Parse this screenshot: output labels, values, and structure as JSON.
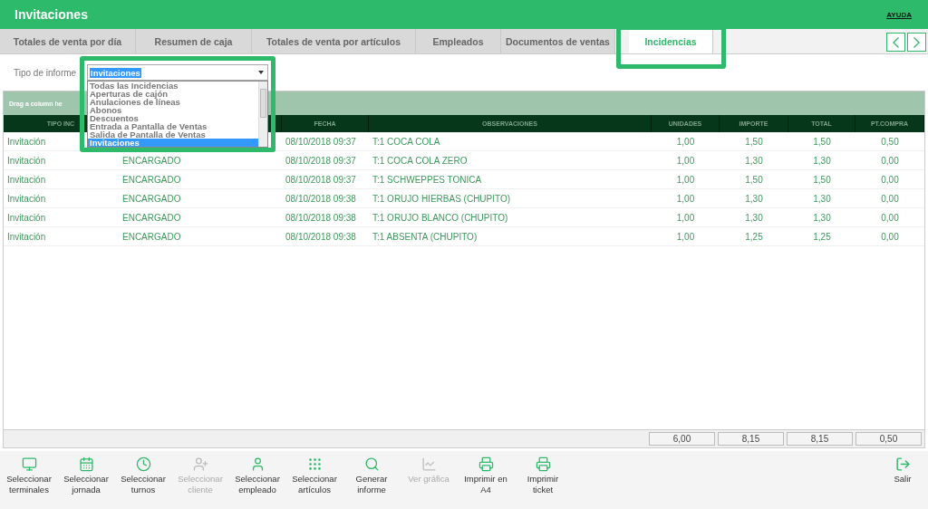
{
  "window": {
    "title": "Invitaciones",
    "help_link": "AYUDA"
  },
  "tabs": [
    {
      "label": "Totales de venta por día",
      "selected": false
    },
    {
      "label": "Resumen de caja",
      "selected": false
    },
    {
      "label": "Totales de venta por artículos",
      "selected": false
    },
    {
      "label": "Empleados",
      "selected": false
    },
    {
      "label": "Documentos de ventas",
      "selected": false
    },
    {
      "label": "Incidencias",
      "selected": true
    }
  ],
  "report_type": {
    "label": "Tipo de informe",
    "value": "Invitaciones",
    "expanded": true,
    "options": [
      {
        "label": "Todas las Incidencias",
        "selected": false
      },
      {
        "label": "Aperturas de cajón",
        "selected": false
      },
      {
        "label": "Anulaciones de líneas",
        "selected": false
      },
      {
        "label": "Abonos",
        "selected": false
      },
      {
        "label": "Descuentos",
        "selected": false
      },
      {
        "label": "Entrada a Pantalla de Ventas",
        "selected": false
      },
      {
        "label": "Salida de Pantalla de Ventas",
        "selected": false
      },
      {
        "label": "Invitaciones",
        "selected": true
      }
    ]
  },
  "table": {
    "group_hint": "Drag a column he",
    "columns": [
      "TIPO INC",
      "",
      "FECHA",
      "OBSERVACIONES",
      "UNIDADES",
      "IMPORTE",
      "TOTAL",
      "PT.COMPRA"
    ],
    "rows": [
      {
        "cells": [
          "Invitación",
          null,
          "08/10/2018 09:37",
          "T:1 COCA COLA",
          "1,00",
          "1,50",
          "1,50",
          "0,50"
        ]
      },
      {
        "cells": [
          "Invitación",
          "ENCARGADO",
          "08/10/2018 09:37",
          "T:1 COCA COLA ZERO",
          "1,00",
          "1,30",
          "1,30",
          "0,00"
        ]
      },
      {
        "cells": [
          "Invitación",
          "ENCARGADO",
          "08/10/2018 09:37",
          "T:1 SCHWEPPES TONICA",
          "1,00",
          "1,50",
          "1,50",
          "0,00"
        ]
      },
      {
        "cells": [
          "Invitación",
          "ENCARGADO",
          "08/10/2018 09:38",
          "T:1 ORUJO HIERBAS (CHUPITO)",
          "1,00",
          "1,30",
          "1,30",
          "0,00"
        ]
      },
      {
        "cells": [
          "Invitación",
          "ENCARGADO",
          "08/10/2018 09:38",
          "T:1 ORUJO BLANCO (CHUPITO)",
          "1,00",
          "1,30",
          "1,30",
          "0,00"
        ]
      },
      {
        "cells": [
          "Invitación",
          "ENCARGADO",
          "08/10/2018 09:38",
          "T:1 ABSENTA (CHUPITO)",
          "1,00",
          "1,25",
          "1,25",
          "0,00"
        ]
      }
    ],
    "totals": [
      "6,00",
      "8,15",
      "8,15",
      "0,50"
    ]
  },
  "toolbar": [
    {
      "kind": "terminal",
      "label": "Seleccionar terminales",
      "disabled": false
    },
    {
      "kind": "calendar",
      "label": "Seleccionar jornada",
      "disabled": false
    },
    {
      "kind": "clock",
      "label": "Seleccionar turnos",
      "disabled": false
    },
    {
      "kind": "user-plus",
      "label": "Seleccionar cliente",
      "disabled": true
    },
    {
      "kind": "user",
      "label": "Seleccionar empleado",
      "disabled": false
    },
    {
      "kind": "grid",
      "label": "Seleccionar artículos",
      "disabled": false
    },
    {
      "kind": "search",
      "label": "Generar informe",
      "disabled": false
    },
    {
      "kind": "chart",
      "label": "Ver gráfica",
      "disabled": true
    },
    {
      "kind": "printer",
      "label": "Imprimir en A4",
      "disabled": false
    },
    {
      "kind": "printer",
      "label": "Imprimir ticket",
      "disabled": false
    }
  ],
  "exit_button": {
    "label": "Salir"
  }
}
